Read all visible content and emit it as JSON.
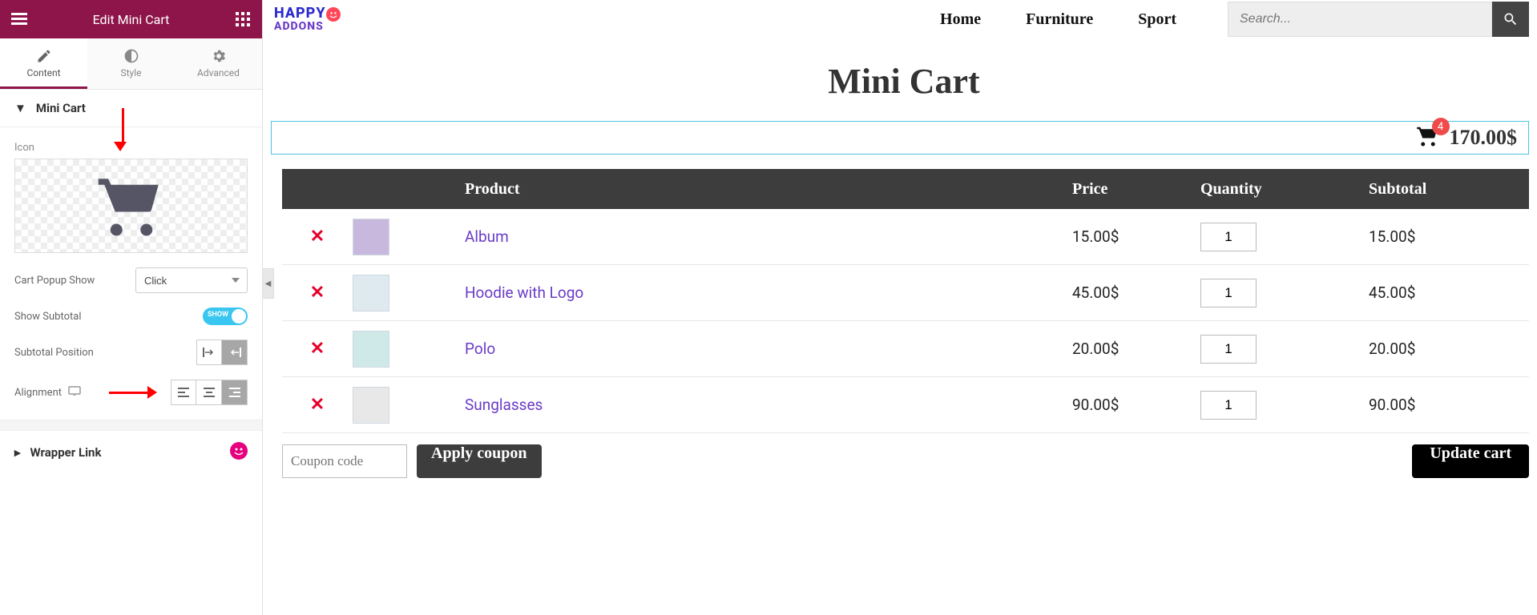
{
  "panel": {
    "title": "Edit Mini Cart",
    "tabs": {
      "content": "Content",
      "style": "Style",
      "advanced": "Advanced"
    },
    "sections": {
      "mini_cart": {
        "title": "Mini Cart"
      },
      "wrapper_link": {
        "title": "Wrapper Link"
      }
    },
    "controls": {
      "icon_label": "Icon",
      "cart_popup_show": {
        "label": "Cart Popup Show",
        "value": "Click"
      },
      "show_subtotal": {
        "label": "Show Subtotal",
        "value": "SHOW"
      },
      "subtotal_position": {
        "label": "Subtotal Position"
      },
      "alignment": {
        "label": "Alignment"
      }
    }
  },
  "preview": {
    "logo": {
      "line1": "HAPPY",
      "line2": "ADDONS"
    },
    "nav": [
      "Home",
      "Furniture",
      "Sport"
    ],
    "search_placeholder": "Search...",
    "page_title": "Mini Cart",
    "minicart": {
      "count": "4",
      "total": "170.00$"
    },
    "table": {
      "headers": {
        "product": "Product",
        "price": "Price",
        "quantity": "Quantity",
        "subtotal": "Subtotal"
      },
      "rows": [
        {
          "name": "Album",
          "price": "15.00$",
          "qty": "1",
          "subtotal": "15.00$"
        },
        {
          "name": "Hoodie with Logo",
          "price": "45.00$",
          "qty": "1",
          "subtotal": "45.00$"
        },
        {
          "name": "Polo",
          "price": "20.00$",
          "qty": "1",
          "subtotal": "20.00$"
        },
        {
          "name": "Sunglasses",
          "price": "90.00$",
          "qty": "1",
          "subtotal": "90.00$"
        }
      ]
    },
    "coupon_placeholder": "Coupon code",
    "apply_coupon": "Apply coupon",
    "update_cart": "Update cart"
  }
}
